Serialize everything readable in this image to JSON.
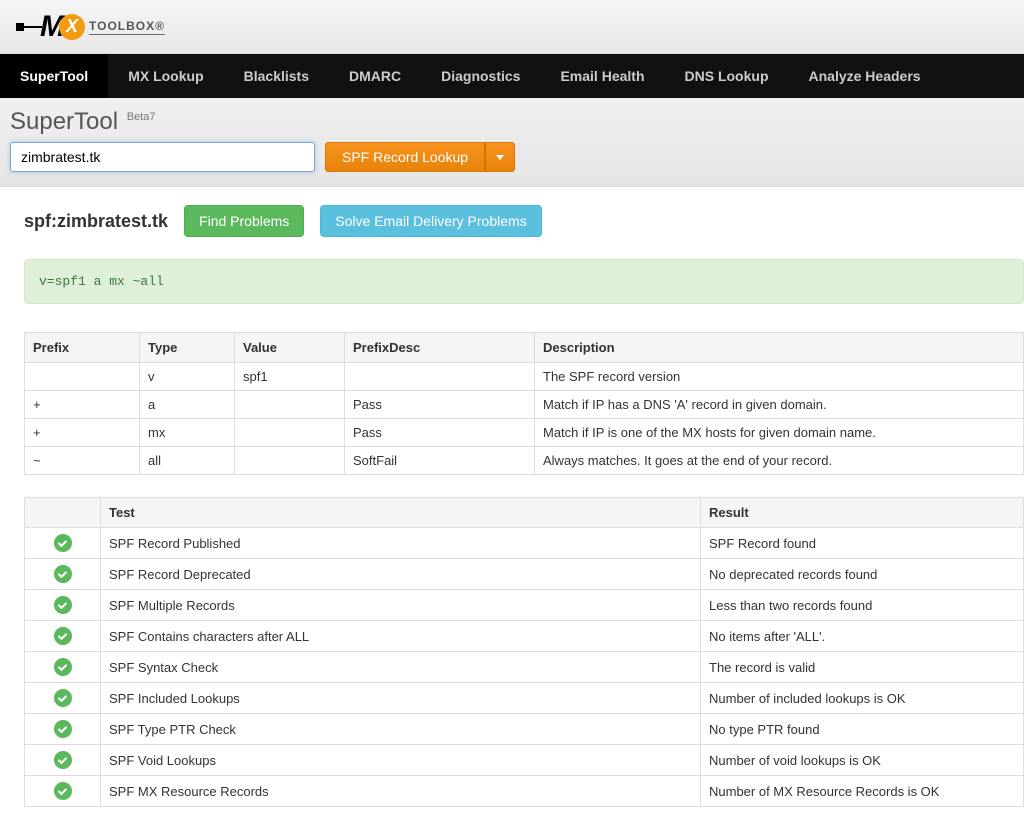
{
  "logo": {
    "toolbox_text": "TOOLBOX®"
  },
  "nav": [
    {
      "label": "SuperTool",
      "active": true
    },
    {
      "label": "MX Lookup",
      "active": false
    },
    {
      "label": "Blacklists",
      "active": false
    },
    {
      "label": "DMARC",
      "active": false
    },
    {
      "label": "Diagnostics",
      "active": false
    },
    {
      "label": "Email Health",
      "active": false
    },
    {
      "label": "DNS Lookup",
      "active": false
    },
    {
      "label": "Analyze Headers",
      "active": false
    }
  ],
  "tool": {
    "title": "SuperTool",
    "beta": "Beta7",
    "input_value": "zimbratest.tk",
    "lookup_button": "SPF Record Lookup"
  },
  "result": {
    "title": "spf:zimbratest.tk",
    "find_problems_btn": "Find Problems",
    "solve_problems_btn": "Solve Email Delivery Problems",
    "spf_string": "v=spf1 a mx ~all"
  },
  "prefix_table": {
    "headers": [
      "Prefix",
      "Type",
      "Value",
      "PrefixDesc",
      "Description"
    ],
    "rows": [
      {
        "prefix": "",
        "type": "v",
        "value": "spf1",
        "prefixdesc": "",
        "description": "The SPF record version"
      },
      {
        "prefix": "+",
        "type": "a",
        "value": "",
        "prefixdesc": "Pass",
        "description": "Match if IP has a DNS 'A' record in given domain."
      },
      {
        "prefix": "+",
        "type": "mx",
        "value": "",
        "prefixdesc": "Pass",
        "description": "Match if IP is one of the MX hosts for given domain name."
      },
      {
        "prefix": "~",
        "type": "all",
        "value": "",
        "prefixdesc": "SoftFail",
        "description": "Always matches. It goes at the end of your record."
      }
    ]
  },
  "test_table": {
    "headers": [
      "",
      "Test",
      "Result"
    ],
    "rows": [
      {
        "status": "ok",
        "test": "SPF Record Published",
        "result": "SPF Record found"
      },
      {
        "status": "ok",
        "test": "SPF Record Deprecated",
        "result": "No deprecated records found"
      },
      {
        "status": "ok",
        "test": "SPF Multiple Records",
        "result": "Less than two records found"
      },
      {
        "status": "ok",
        "test": "SPF Contains characters after ALL",
        "result": "No items after 'ALL'."
      },
      {
        "status": "ok",
        "test": "SPF Syntax Check",
        "result": "The record is valid"
      },
      {
        "status": "ok",
        "test": "SPF Included Lookups",
        "result": "Number of included lookups is OK"
      },
      {
        "status": "ok",
        "test": "SPF Type PTR Check",
        "result": "No type PTR found"
      },
      {
        "status": "ok",
        "test": "SPF Void Lookups",
        "result": "Number of void lookups is OK"
      },
      {
        "status": "ok",
        "test": "SPF MX Resource Records",
        "result": "Number of MX Resource Records is OK"
      }
    ]
  }
}
